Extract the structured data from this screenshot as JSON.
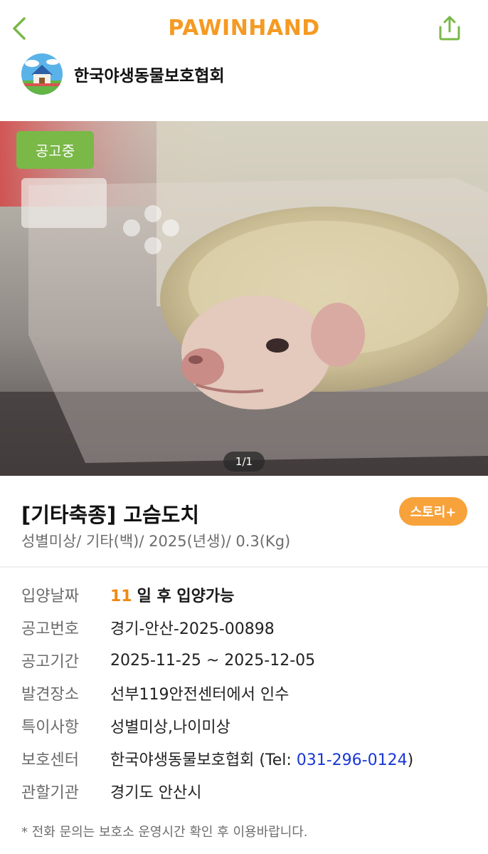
{
  "app": {
    "brand": "PAWINHAND"
  },
  "shelter": {
    "name": "한국야생동물보호협회"
  },
  "photo": {
    "status_badge": "공고중",
    "page_indicator": "1/1"
  },
  "animal": {
    "title": "[기타축종] 고슴도치",
    "summary": "성별미상/ 기타(백)/ 2025(년생)/ 0.3(Kg)",
    "story_button": "스토리+"
  },
  "details": {
    "adoption_date": {
      "label": "입양날짜",
      "days": "11",
      "text": "일 후 입양가능"
    },
    "notice_number": {
      "label": "공고번호",
      "value": "경기-안산-2025-00898"
    },
    "notice_period": {
      "label": "공고기간",
      "value": "2025-11-25 ~ 2025-12-05"
    },
    "found_place": {
      "label": "발견장소",
      "value": "선부119안전센터에서 인수"
    },
    "special_notes": {
      "label": "특이사항",
      "value": "성별미상,나이미상"
    },
    "shelter_center": {
      "label": "보호센터",
      "name": "한국야생동물보호협회",
      "tel_prefix": "(Tel: ",
      "tel": "031-296-0124",
      "tel_suffix": ")"
    },
    "jurisdiction": {
      "label": "관할기관",
      "value": "경기도 안산시"
    }
  },
  "footnote": "* 전화 문의는 보호소 운영시간 확인 후 이용바랍니다.",
  "colors": {
    "brand": "#f59a23",
    "accent_green": "#7ab848",
    "story_orange": "#f7a23a",
    "phone_blue": "#1a37d6"
  },
  "icons": {
    "back": "chevron-left-icon",
    "share": "share-icon"
  }
}
